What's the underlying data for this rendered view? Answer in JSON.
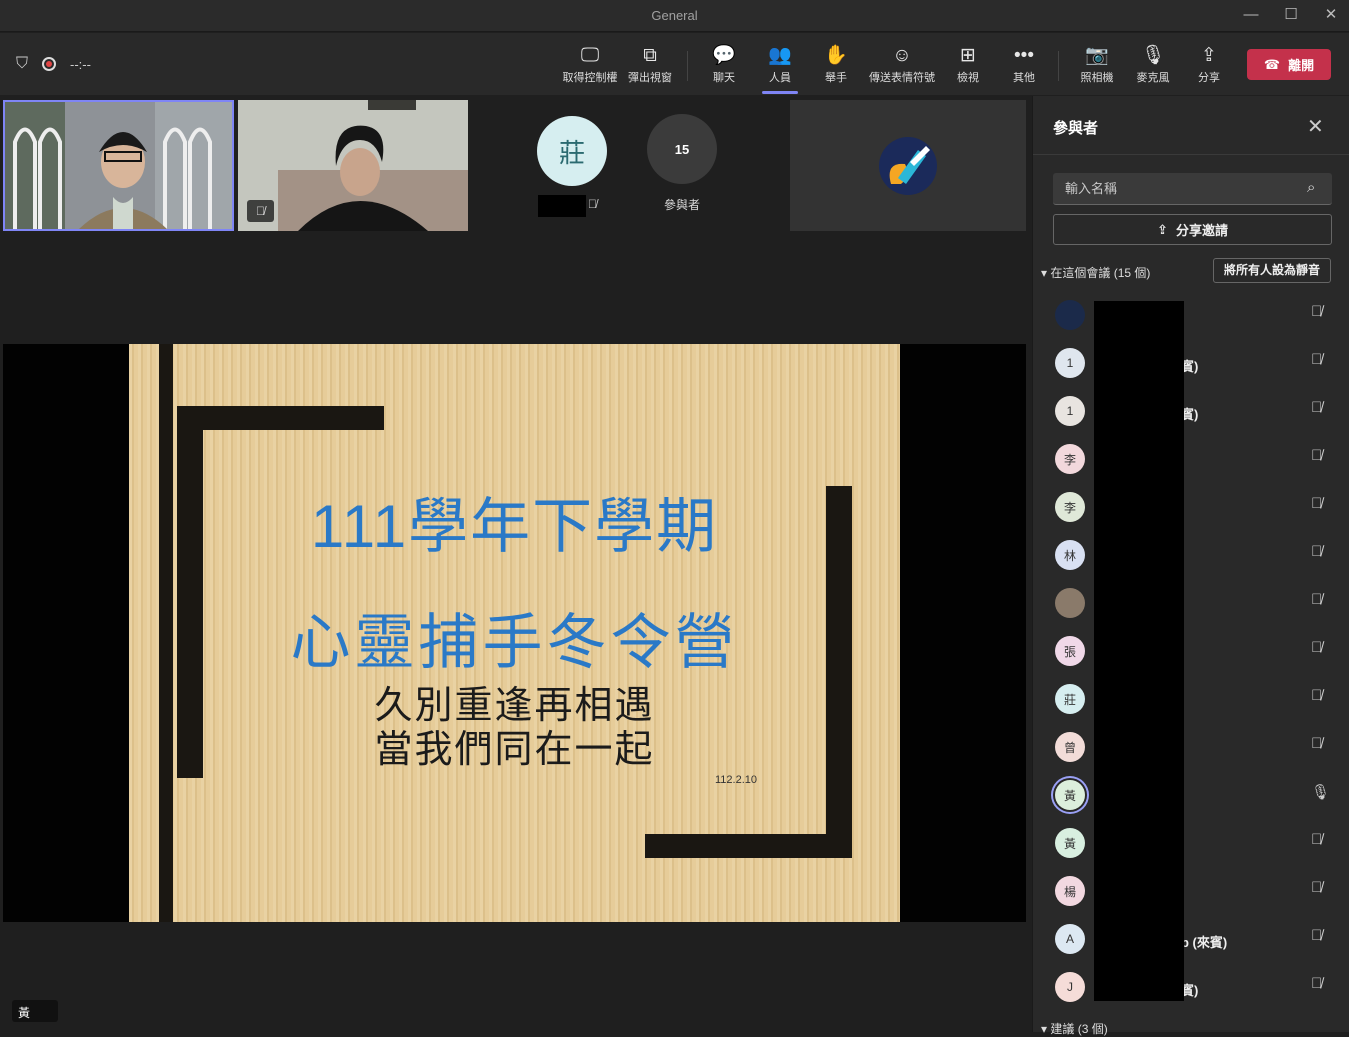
{
  "window": {
    "title": "General"
  },
  "toolbar": {
    "timer": "--:--",
    "buttons": [
      {
        "label": "取得控制權",
        "icon": "screen-control-icon"
      },
      {
        "label": "彈出視窗",
        "icon": "popout-icon"
      },
      {
        "label": "聊天",
        "icon": "chat-icon"
      },
      {
        "label": "人員",
        "icon": "people-icon"
      },
      {
        "label": "舉手",
        "icon": "raise-hand-icon"
      },
      {
        "label": "傳送表情符號",
        "icon": "emoji-icon"
      },
      {
        "label": "檢視",
        "icon": "view-icon"
      },
      {
        "label": "其他",
        "icon": "more-icon"
      },
      {
        "label": "照相機",
        "icon": "camera-off-icon"
      },
      {
        "label": "麥克風",
        "icon": "mic-off-icon"
      },
      {
        "label": "分享",
        "icon": "share-icon"
      }
    ],
    "leave_label": "離開"
  },
  "gallery": {
    "avatar_initial": "莊",
    "participant_count": "15",
    "participant_label": "參與者"
  },
  "slide": {
    "line1": "111學年下學期",
    "line2": "心靈捕手冬令營",
    "line3a": "久別重逢再相遇",
    "line3b": "當我們同在一起",
    "date": "112.2.10"
  },
  "self_chip": "黃",
  "panel": {
    "title": "參與者",
    "search_placeholder": "輸入名稱",
    "share_invite": "分享邀請",
    "in_meeting": "在這個會議 (15 個)",
    "mute_all": "將所有人設為靜音",
    "suggestions": "建議 (3 個)",
    "participants": [
      {
        "initial": "",
        "name": "",
        "color": "#1b2a4a"
      },
      {
        "initial": "1",
        "name": "賓)",
        "color": "#dfe6ee"
      },
      {
        "initial": "1",
        "name": "賓)",
        "color": "#e8e4e0"
      },
      {
        "initial": "李",
        "name": "",
        "color": "#f2d8dc"
      },
      {
        "initial": "李",
        "name": "",
        "color": "#dfe8d8"
      },
      {
        "initial": "林",
        "name": "",
        "color": "#d8e0f2"
      },
      {
        "initial": "",
        "name": "",
        "color": "#8a7a6a"
      },
      {
        "initial": "張",
        "name": "",
        "color": "#f0d8e8"
      },
      {
        "initial": "莊",
        "name": "",
        "color": "#d6eef0"
      },
      {
        "initial": "曾",
        "name": "",
        "color": "#f2dcd8"
      },
      {
        "initial": "黃",
        "name": "",
        "color": "#dcefdc"
      },
      {
        "initial": "黃",
        "name": "",
        "color": "#d8efe0"
      },
      {
        "initial": "楊",
        "name": "",
        "color": "#f2d8e0"
      },
      {
        "initial": "A",
        "name": "p (來賓)",
        "color": "#dce8f2"
      },
      {
        "initial": "J",
        "name": "賓)",
        "color": "#f5dcd8"
      }
    ]
  }
}
